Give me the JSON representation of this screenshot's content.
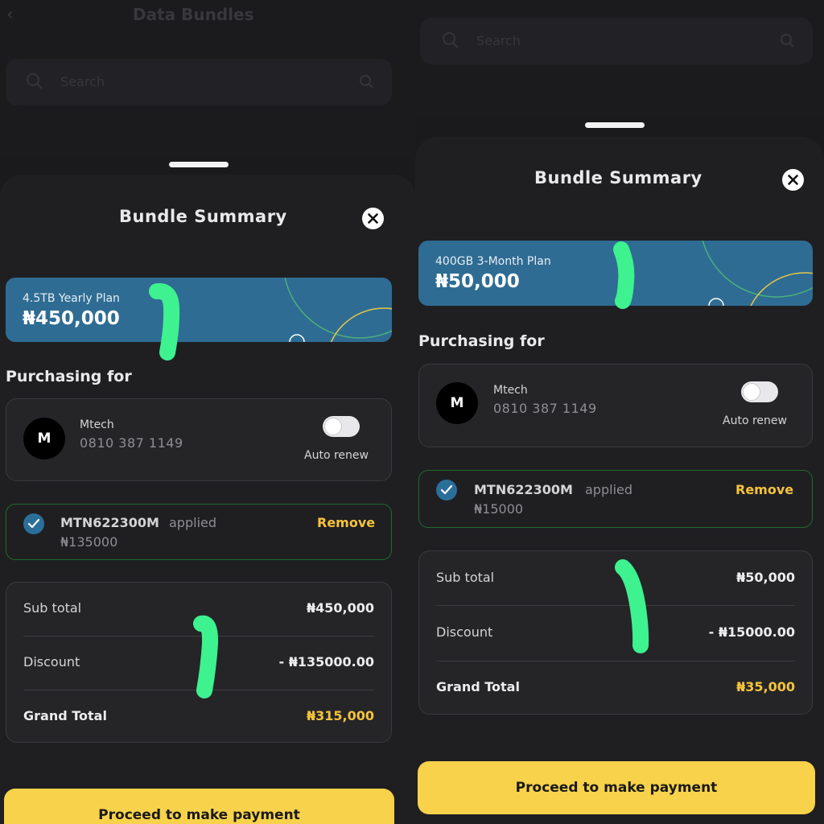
{
  "background_screen": {
    "title": "Data Bundles",
    "search_placeholder": "Search"
  },
  "sheets": [
    {
      "title": "Bundle Summary",
      "plan": {
        "name": "4.5TB Yearly Plan",
        "price": "₦450,000"
      },
      "purchasing_label": "Purchasing for",
      "account": {
        "initial": "M",
        "name": "Mtech",
        "phone": "0810 387 1149",
        "auto_renew_label": "Auto renew",
        "auto_renew_on": false
      },
      "promo": {
        "code": "MTN622300M",
        "status": "applied",
        "amount": "₦135000",
        "remove_label": "Remove"
      },
      "summary": {
        "rows": [
          {
            "label": "Sub total",
            "value": "₦450,000"
          },
          {
            "label": "Discount",
            "value": "- ₦135000.00"
          },
          {
            "label": "Grand Total",
            "value": "₦315,000"
          }
        ]
      },
      "pay_button": "Proceed to make payment"
    },
    {
      "title": "Bundle Summary",
      "plan": {
        "name": "400GB 3-Month Plan",
        "price": "₦50,000"
      },
      "purchasing_label": "Purchasing for",
      "account": {
        "initial": "M",
        "name": "Mtech",
        "phone": "0810 387 1149",
        "auto_renew_label": "Auto renew",
        "auto_renew_on": false
      },
      "promo": {
        "code": "MTN622300M",
        "status": "applied",
        "amount": "₦15000",
        "remove_label": "Remove"
      },
      "summary": {
        "rows": [
          {
            "label": "Sub total",
            "value": "₦50,000"
          },
          {
            "label": "Discount",
            "value": "- ₦15000.00"
          },
          {
            "label": "Grand Total",
            "value": "₦35,000"
          }
        ]
      },
      "pay_button": "Proceed to make payment"
    }
  ],
  "colors": {
    "plan_card": "#2f6c93",
    "accent_gold": "#f5c33b",
    "pay_button": "#f8d24a",
    "promo_border": "#1f6a2c",
    "highlighter": "#3df28f"
  }
}
